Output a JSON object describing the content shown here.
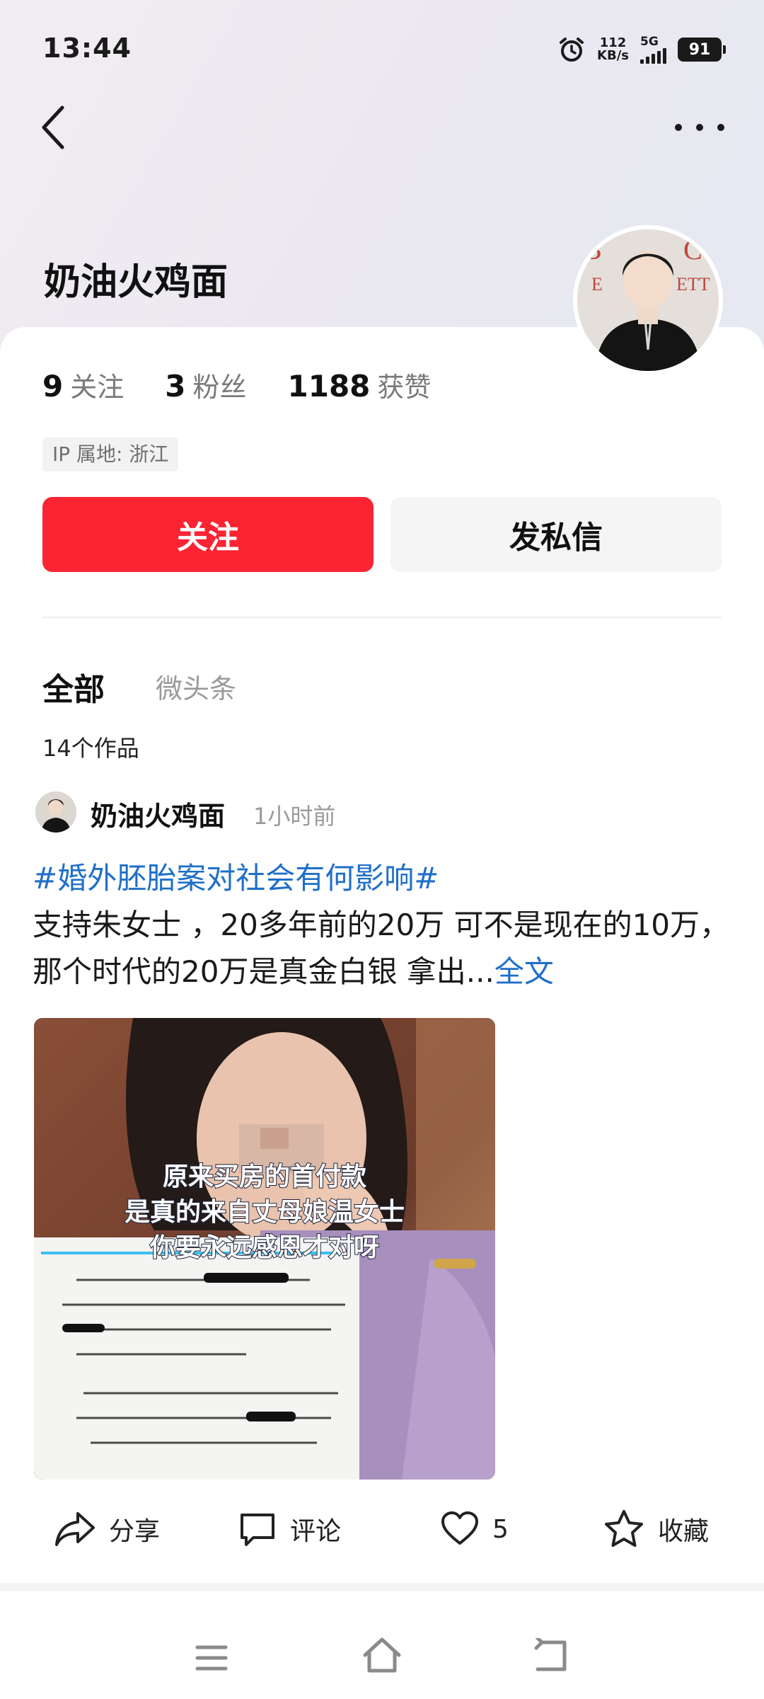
{
  "status_bar": {
    "time": "13:44",
    "net_speed_value": "112",
    "net_speed_unit": "KB/s",
    "network": "5G",
    "battery": "91"
  },
  "header": {
    "back_icon": "chevron-left-icon",
    "more_icon": "more-dots-icon"
  },
  "profile": {
    "name": "奶油火鸡面",
    "stats": [
      {
        "num": "9",
        "label": "关注"
      },
      {
        "num": "3",
        "label": "粉丝"
      },
      {
        "num": "1188",
        "label": "获赞"
      }
    ],
    "ip_location": "IP 属地: 浙江",
    "follow_button": "关注",
    "message_button": "发私信"
  },
  "tabs": {
    "all": "全部",
    "micro": "微头条"
  },
  "works_count": "14个作品",
  "post": {
    "author": "奶油火鸡面",
    "time": "1小时前",
    "hashtag": "#婚外胚胎案对社会有何影响#",
    "text": "支持朱女士 ，20多年前的20万 可不是现在的10万，那个时代的20万是真金白银 拿出...",
    "full_text_link": "全文",
    "image_caption_lines": [
      "原来买房的首付款",
      "是真的来自丈母娘温女士",
      "你要永远感恩才对呀"
    ],
    "actions": {
      "share": "分享",
      "comment": "评论",
      "likes": "5",
      "favorite": "收藏"
    }
  },
  "colors": {
    "follow_red": "#fa2433",
    "link_blue": "#1f6fc8"
  }
}
